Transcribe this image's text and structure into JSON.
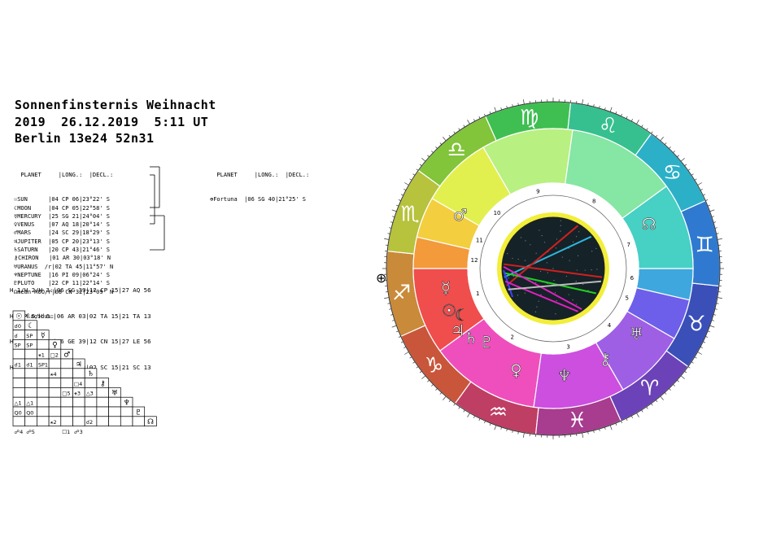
{
  "header": {
    "line1": "Sonnenfinsternis Weihnacht",
    "line2": "2019  26.12.2019  5:11 UT",
    "line3": "Berlin 13e24 52n31"
  },
  "planets_table": {
    "header": "  PLANET     |LONG.:  |DECL.:",
    "rows": [
      {
        "glyph": "☉",
        "text": "SUN      |04 CP 06|23°22' S"
      },
      {
        "glyph": "☾",
        "text": "MOON     |04 CP 05|22°58' S"
      },
      {
        "glyph": "☿",
        "text": "MERCURY  |25 SG 21|24°04' S"
      },
      {
        "glyph": "♀",
        "text": "VENUS    |07 AQ 18|20°14' S"
      },
      {
        "glyph": "♂",
        "text": "MARS     |24 SC 29|18°29' S"
      },
      {
        "glyph": "♃",
        "text": "JUPITER  |05 CP 20|23°13' S"
      },
      {
        "glyph": "♄",
        "text": "SATURN   |20 CP 43|21°46' S"
      },
      {
        "glyph": "⚷",
        "text": "CHIRON   |01 AR 30|03°18' N"
      },
      {
        "glyph": "♅",
        "text": "URANUS  /r|02 TA 45|11°57' N"
      },
      {
        "glyph": "♆",
        "text": "NEPTUNE  |16 PI 09|06°24' S"
      },
      {
        "glyph": "♇",
        "text": "PLUTO    |22 CP 11|22°14' S"
      },
      {
        "glyph": "☊",
        "text": "mean MOO/r|08 CN 32|23°09' N"
      }
    ],
    "placidus_label": "Placidus:"
  },
  "fortuna_table": {
    "header": "  PLANET     |LONG.:  |DECL.:",
    "row_glyph": "⊕",
    "row_text": "Fortuna  |06 SG 40|21°25' S"
  },
  "houses": [
    "H 1/H 2/H 3:|06 SG 39|12 CP 15|27 AQ 56",
    "H 4/H 5/H 6:|06 AR 03|02 TA 15|21 TA 13",
    "H 7/H 8/H 9:|06 GE 39|12 CN 15|27 LE 56",
    "H10/H11/H12:|06 LI 03|02 SC 15|21 SC 13"
  ],
  "aspect_grid": {
    "planet_glyphs": [
      "☉",
      "☾",
      "☿",
      "♀",
      "♂",
      "♃",
      "♄",
      "⚷",
      "♅",
      "♆",
      "♇",
      "☊"
    ],
    "cells": [
      {
        "r": 1,
        "c": 0,
        "t": "☌0"
      },
      {
        "r": 2,
        "c": 0,
        "t": "☌"
      },
      {
        "r": 2,
        "c": 1,
        "t": "SP"
      },
      {
        "r": 3,
        "c": 0,
        "t": "SP"
      },
      {
        "r": 3,
        "c": 1,
        "t": "SP"
      },
      {
        "r": 4,
        "c": 2,
        "t": "⚹1"
      },
      {
        "r": 4,
        "c": 3,
        "t": "□2"
      },
      {
        "r": 5,
        "c": 0,
        "t": "☌1"
      },
      {
        "r": 5,
        "c": 1,
        "t": "☌1"
      },
      {
        "r": 5,
        "c": 2,
        "t": "SP1"
      },
      {
        "r": 6,
        "c": 3,
        "t": "⚹4"
      },
      {
        "r": 7,
        "c": 5,
        "t": "□4"
      },
      {
        "r": 8,
        "c": 4,
        "t": "□5"
      },
      {
        "r": 8,
        "c": 5,
        "t": "⚹3"
      },
      {
        "r": 8,
        "c": 6,
        "t": "△3"
      },
      {
        "r": 9,
        "c": 0,
        "t": "△1"
      },
      {
        "r": 9,
        "c": 1,
        "t": "△1"
      },
      {
        "r": 10,
        "c": 0,
        "t": "Q0"
      },
      {
        "r": 10,
        "c": 1,
        "t": "Q0"
      },
      {
        "r": 11,
        "c": 3,
        "t": "⚹2"
      },
      {
        "r": 11,
        "c": 6,
        "t": "☌2"
      },
      {
        "r": 12,
        "c": 0,
        "t": "☍4"
      },
      {
        "r": 12,
        "c": 1,
        "t": "☍5"
      },
      {
        "r": 12,
        "c": 4,
        "t": "☐1"
      },
      {
        "r": 12,
        "c": 5,
        "t": "☍3"
      }
    ]
  },
  "wheel": {
    "signs": [
      "♈",
      "♉",
      "♊",
      "♋",
      "♌",
      "♍",
      "♎",
      "♏",
      "♐",
      "♑",
      "♒",
      "♓"
    ],
    "house_numbers": [
      "1",
      "2",
      "3",
      "4",
      "5",
      "6",
      "7",
      "8",
      "9",
      "10",
      "11",
      "12"
    ],
    "fortuna_glyph": "⊕",
    "planet_glyphs_in_wheel": [
      {
        "name": "sun",
        "glyph": "☉"
      },
      {
        "name": "moon",
        "glyph": "☾"
      },
      {
        "name": "mercury",
        "glyph": "☿"
      },
      {
        "name": "venus",
        "glyph": "♀"
      },
      {
        "name": "mars",
        "glyph": "♂"
      },
      {
        "name": "jupiter",
        "glyph": "♃"
      },
      {
        "name": "saturn",
        "glyph": "♄"
      },
      {
        "name": "chiron",
        "glyph": "⚷"
      },
      {
        "name": "uranus",
        "glyph": "♅"
      },
      {
        "name": "neptune",
        "glyph": "♆"
      },
      {
        "name": "pluto",
        "glyph": "♇"
      },
      {
        "name": "node",
        "glyph": "☊"
      }
    ],
    "colors": {
      "outer_ring": [
        "#6b42b8",
        "#3a4fb8",
        "#2f7ad0",
        "#2cb0c8",
        "#37c08f",
        "#3fbf52",
        "#82c43a",
        "#b7c23d",
        "#c98a3a",
        "#c9563a",
        "#bf3e63",
        "#a83c8f"
      ],
      "inner_sectors": [
        "#f04d4d",
        "#ef4fbd",
        "#cc4fe0",
        "#9e5fe5",
        "#6d5fea",
        "#3ea7dd",
        "#47d0c4",
        "#86e6a3",
        "#b8f081",
        "#e2f04f",
        "#f3ce3e",
        "#f39a3a"
      ]
    }
  }
}
